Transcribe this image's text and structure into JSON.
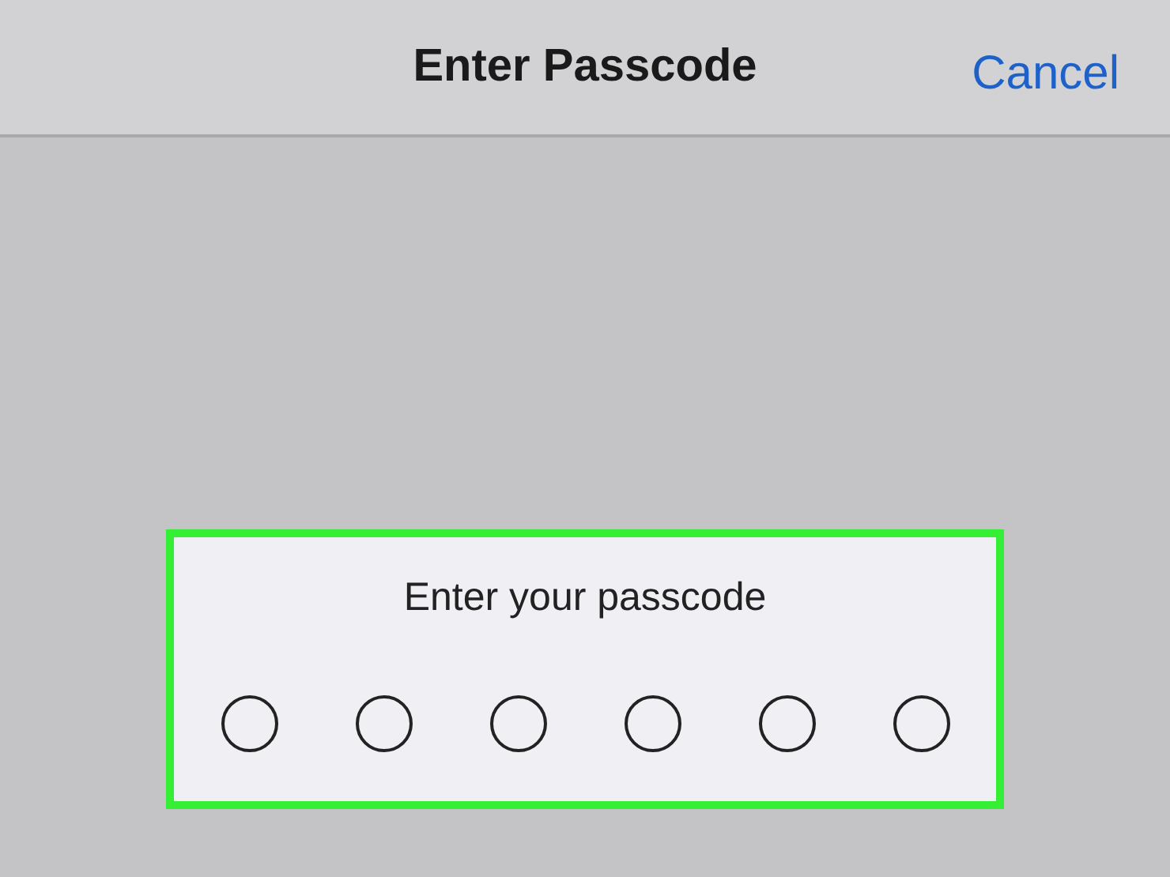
{
  "nav_bar": {
    "title": "Enter Passcode",
    "cancel": "Cancel"
  },
  "passcode_panel": {
    "prompt": "Enter your passcode",
    "highlighted": true,
    "dots": [
      {
        "filled": false
      },
      {
        "filled": false
      },
      {
        "filled": false
      },
      {
        "filled": false
      },
      {
        "filled": false
      },
      {
        "filled": false
      }
    ]
  }
}
